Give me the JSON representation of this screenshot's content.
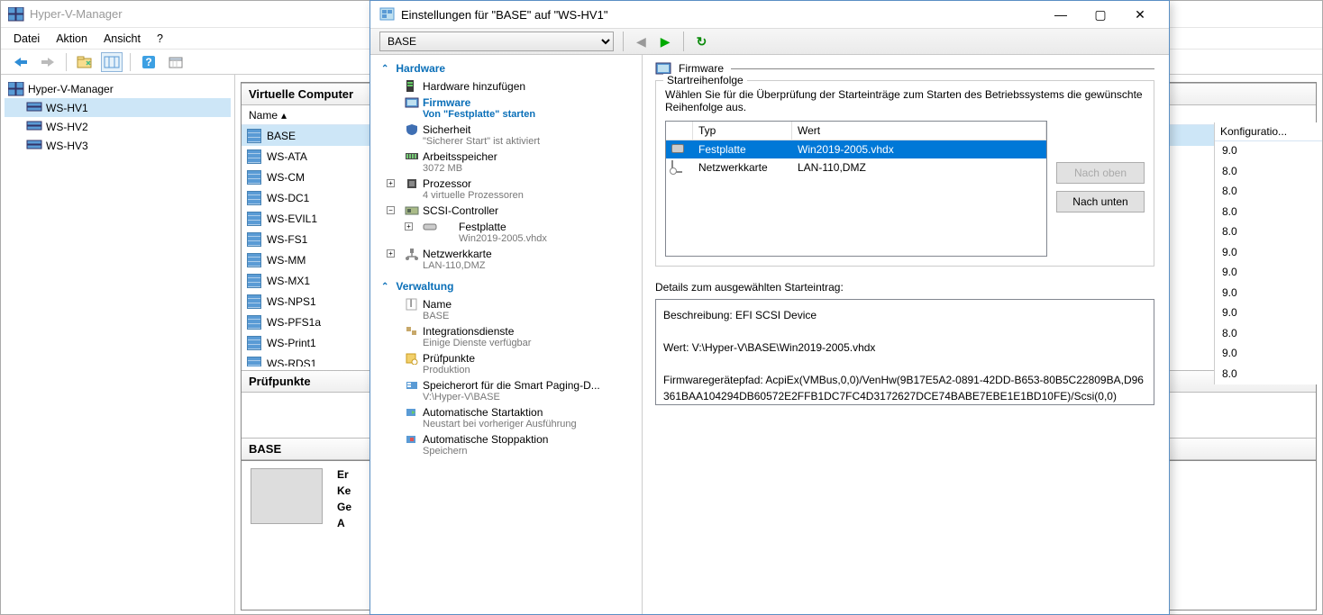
{
  "main": {
    "title": "Hyper-V-Manager",
    "menus": [
      "Datei",
      "Aktion",
      "Ansicht",
      "?"
    ]
  },
  "tree": {
    "root": "Hyper-V-Manager",
    "hosts": [
      "WS-HV1",
      "WS-HV2",
      "WS-HV3"
    ],
    "selected": "WS-HV1"
  },
  "center": {
    "section1": "Virtuelle Computer",
    "nameCol": "Name",
    "vms": [
      "BASE",
      "WS-ATA",
      "WS-CM",
      "WS-DC1",
      "WS-EVIL1",
      "WS-FS1",
      "WS-MM",
      "WS-MX1",
      "WS-NPS1",
      "WS-PFS1a",
      "WS-Print1",
      "WS-RDS1"
    ],
    "selected": "BASE",
    "section2": "Prüfpunkte",
    "detailName": "BASE",
    "detailLabels": [
      "Er",
      "Ke",
      "Ge",
      "A"
    ]
  },
  "rightCol": {
    "header": "Konfiguratio...",
    "values": [
      "9.0",
      "8.0",
      "8.0",
      "8.0",
      "8.0",
      "9.0",
      "9.0",
      "9.0",
      "9.0",
      "8.0",
      "9.0",
      "8.0"
    ]
  },
  "dialog": {
    "title": "Einstellungen für \"BASE\" auf \"WS-HV1\"",
    "vmSelect": "BASE",
    "groups": {
      "hardware": "Hardware",
      "management": "Verwaltung"
    },
    "nodes": {
      "addHw": {
        "label": "Hardware hinzufügen"
      },
      "firmware": {
        "label": "Firmware",
        "sub": "Von \"Festplatte\" starten"
      },
      "security": {
        "label": "Sicherheit",
        "sub": "\"Sicherer Start\" ist aktiviert"
      },
      "memory": {
        "label": "Arbeitsspeicher",
        "sub": "3072 MB"
      },
      "processor": {
        "label": "Prozessor",
        "sub": "4 virtuelle Prozessoren"
      },
      "scsi": {
        "label": "SCSI-Controller"
      },
      "disk": {
        "label": "Festplatte",
        "sub": "Win2019-2005.vhdx"
      },
      "network": {
        "label": "Netzwerkkarte",
        "sub": "LAN-110,DMZ"
      },
      "name": {
        "label": "Name",
        "sub": "BASE"
      },
      "integration": {
        "label": "Integrationsdienste",
        "sub": "Einige Dienste verfügbar"
      },
      "checkpoints": {
        "label": "Prüfpunkte",
        "sub": "Produktion"
      },
      "paging": {
        "label": "Speicherort für die Smart Paging-D...",
        "sub": "V:\\Hyper-V\\BASE"
      },
      "autostart": {
        "label": "Automatische Startaktion",
        "sub": "Neustart bei vorheriger Ausführung"
      },
      "autostop": {
        "label": "Automatische Stoppaktion",
        "sub": "Speichern"
      }
    },
    "right": {
      "panelTitle": "Firmware",
      "fieldset": "Startreihenfolge",
      "desc": "Wählen Sie für die Überprüfung der Starteinträge zum Starten des Betriebssystems die gewünschte Reihenfolge aus.",
      "cols": {
        "type": "Typ",
        "value": "Wert"
      },
      "rows": [
        {
          "type": "Festplatte",
          "value": "Win2019-2005.vhdx"
        },
        {
          "type": "Netzwerkkarte",
          "value": "LAN-110,DMZ"
        }
      ],
      "btnUp": "Nach oben",
      "btnDown": "Nach unten",
      "detailLabel": "Details zum ausgewählten Starteintrag:",
      "detailDesc": "Beschreibung: EFI SCSI Device",
      "detailWert": "Wert: V:\\Hyper-V\\BASE\\Win2019-2005.vhdx",
      "detailPath": "Firmwaregerätepfad: AcpiEx(VMBus,0,0)/VenHw(9B17E5A2-0891-42DD-B653-80B5C22809BA,D96361BAA104294DB60572E2FFB1DC7FC4D3172627DCE74BABE7EBE1E1BD10FE)/Scsi(0,0)"
    }
  }
}
